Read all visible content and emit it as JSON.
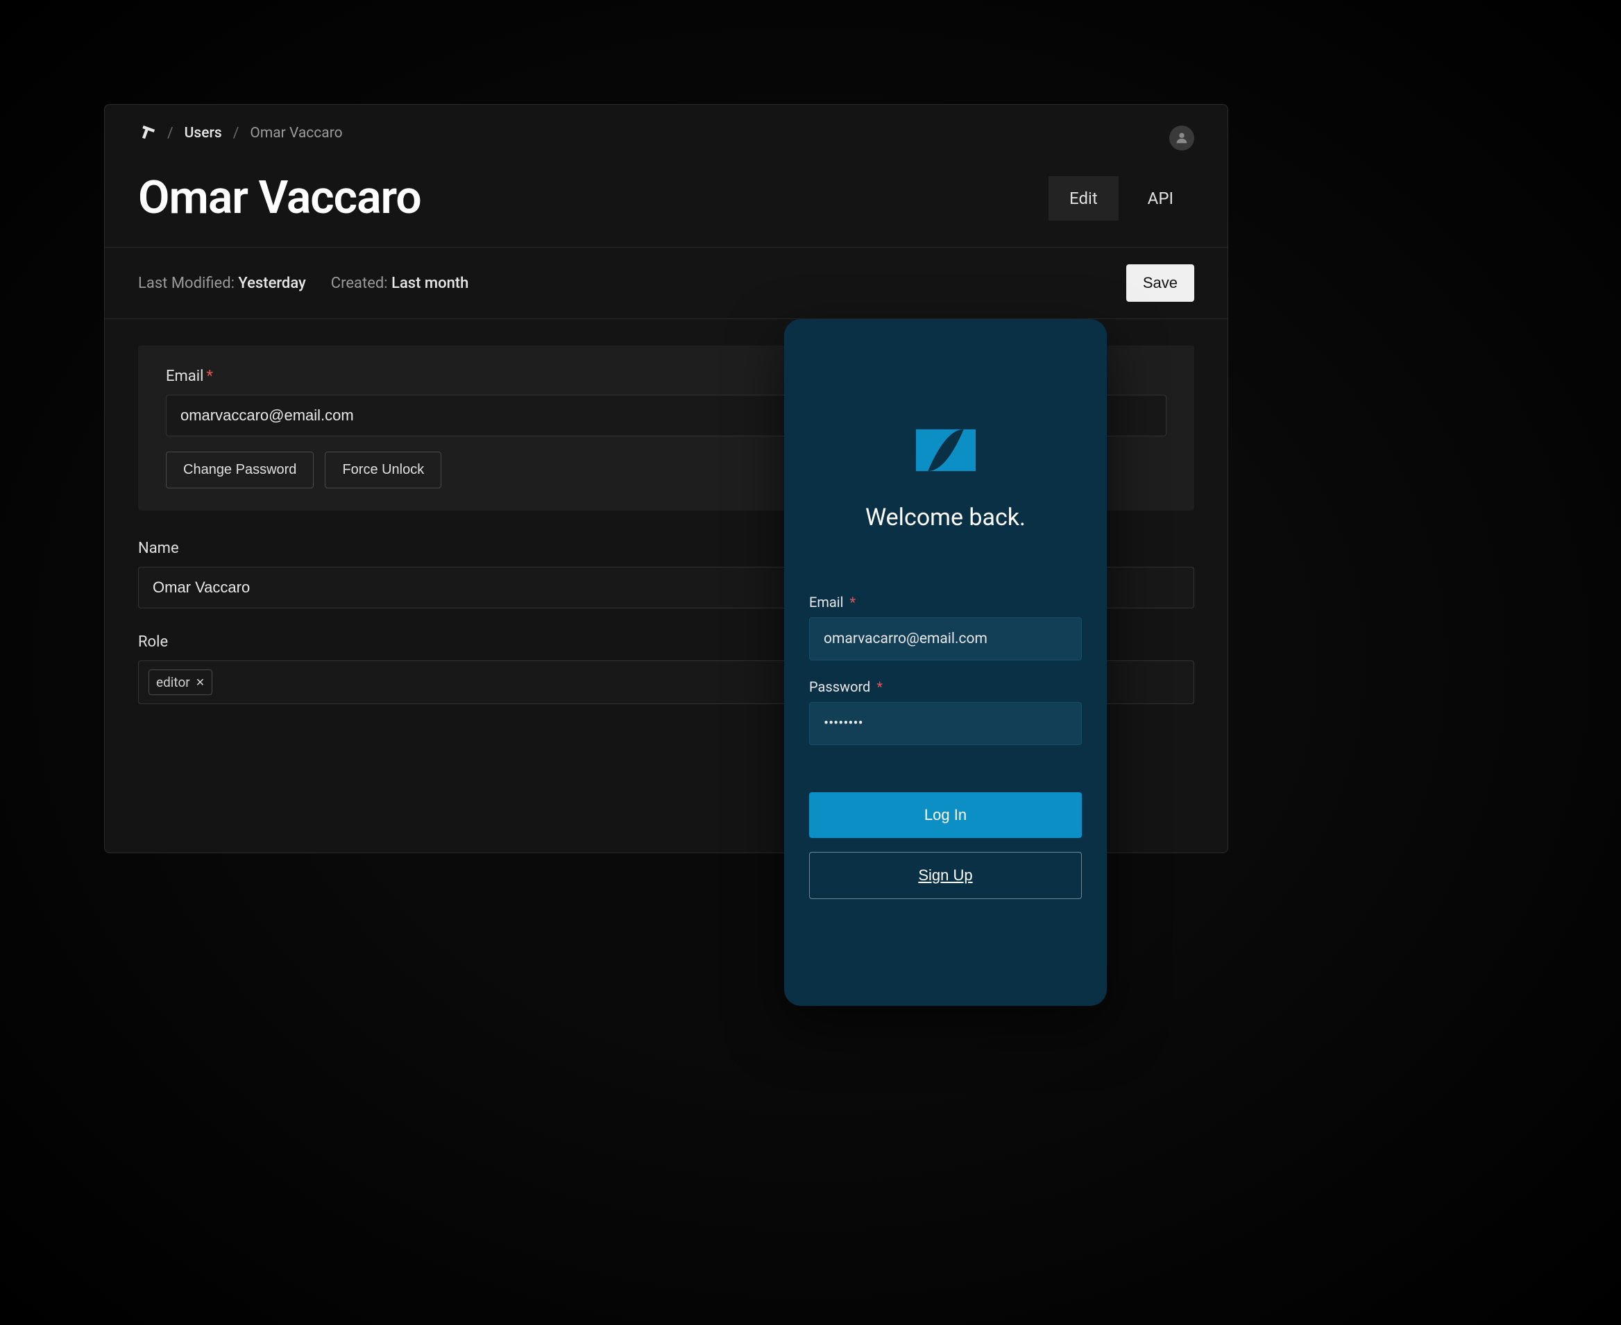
{
  "admin": {
    "breadcrumb": {
      "link": "Users",
      "current": "Omar Vaccaro"
    },
    "title": "Omar Vaccaro",
    "tabs": {
      "edit": "Edit",
      "api": "API"
    },
    "meta": {
      "modified_label": "Last Modified: ",
      "modified_value": "Yesterday",
      "created_label": "Created: ",
      "created_value": "Last month"
    },
    "save_label": "Save",
    "fields": {
      "email_label": "Email",
      "email_value": "omarvaccaro@email.com",
      "change_password_label": "Change Password",
      "force_unlock_label": "Force Unlock",
      "name_label": "Name",
      "name_value": "Omar Vaccaro",
      "role_label": "Role",
      "role_tag": "editor"
    }
  },
  "login": {
    "welcome": "Welcome back.",
    "email_label": "Email",
    "email_value": "omarvacarro@email.com",
    "password_label": "Password",
    "password_value": "••••••••",
    "login_button": "Log In",
    "signup_button": "Sign Up"
  }
}
